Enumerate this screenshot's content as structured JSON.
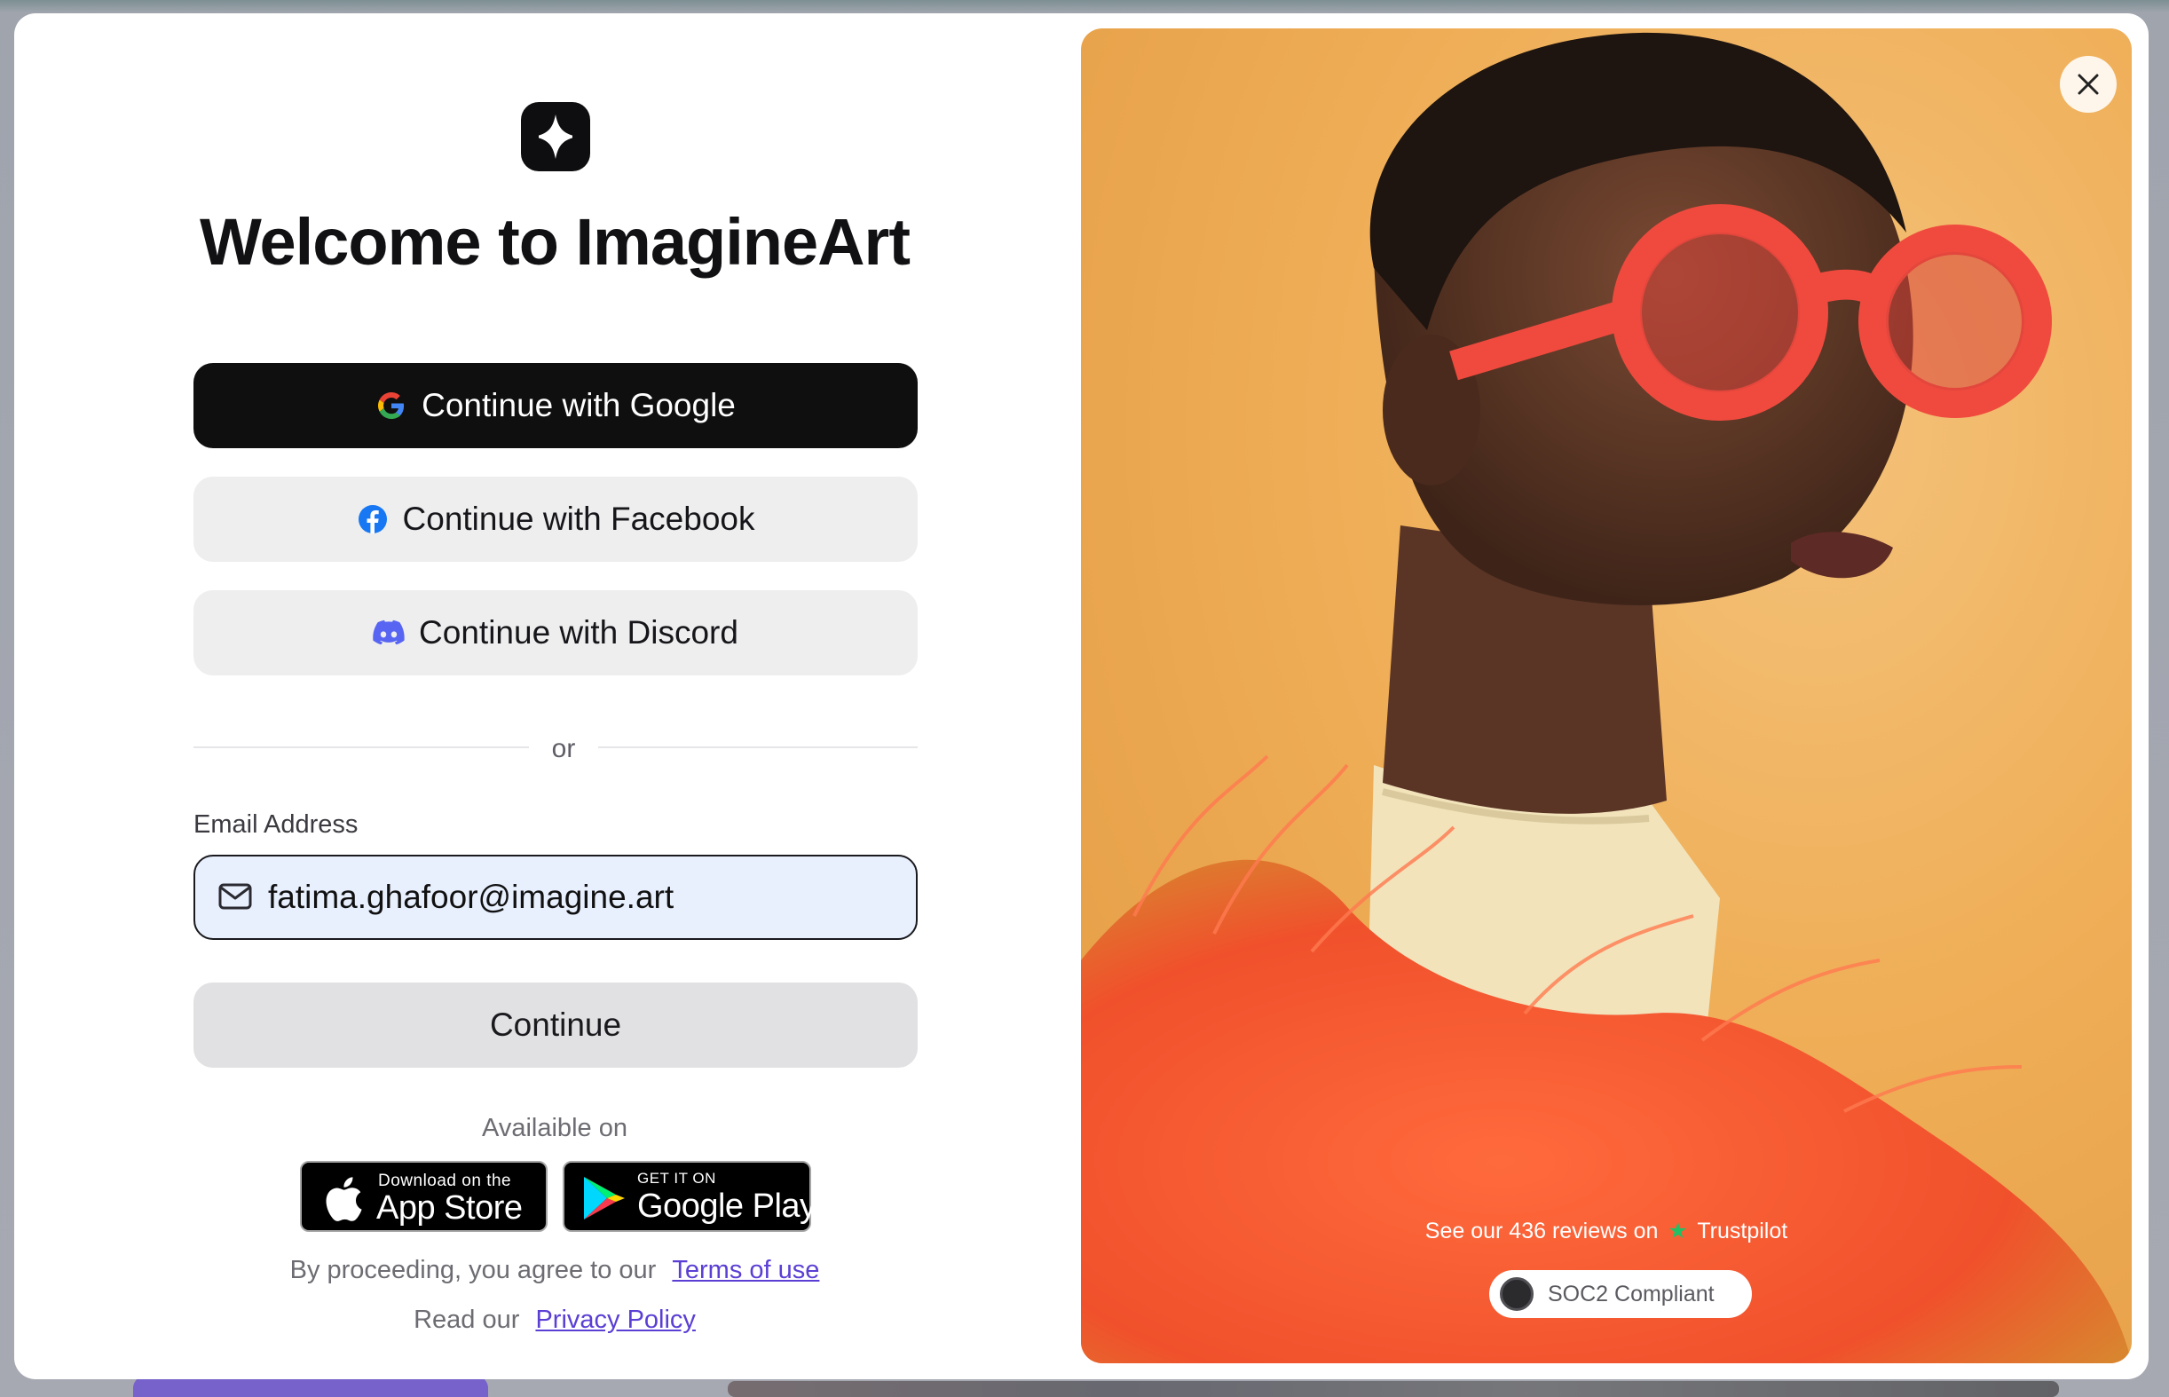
{
  "modal": {
    "title": "Welcome to ImagineArt",
    "auth_buttons": {
      "google": "Continue with Google",
      "facebook": "Continue with Facebook",
      "discord": "Continue with Discord"
    },
    "divider_text": "or",
    "email": {
      "label": "Email Address",
      "value": "fatima.ghafoor@imagine.art"
    },
    "continue_label": "Continue",
    "available_on": "Availaible on",
    "app_store": {
      "small": "Download on the",
      "big": "App Store"
    },
    "google_play": {
      "small": "GET IT ON",
      "big": "Google Play"
    },
    "legal": {
      "terms_prefix": "By proceeding, you agree to our",
      "terms_link": "Terms of use",
      "privacy_prefix": "Read our",
      "privacy_link": "Privacy Policy"
    }
  },
  "promo": {
    "reviews_text": "See our 436 reviews on",
    "reviews_brand": "Trustpilot",
    "badge": "SOC2 Compliant"
  },
  "colors": {
    "primary_button": "#0f0f10",
    "secondary_button": "#eeeeef",
    "link": "#5b3fd4",
    "email_fill": "#e8f0fe",
    "trustpilot_star": "#21c065"
  },
  "icons": [
    "logo-icon",
    "google-icon",
    "facebook-icon",
    "discord-icon",
    "mail-icon",
    "apple-icon",
    "google-play-icon",
    "close-icon",
    "trustpilot-star-icon",
    "soc2-seal-icon"
  ]
}
